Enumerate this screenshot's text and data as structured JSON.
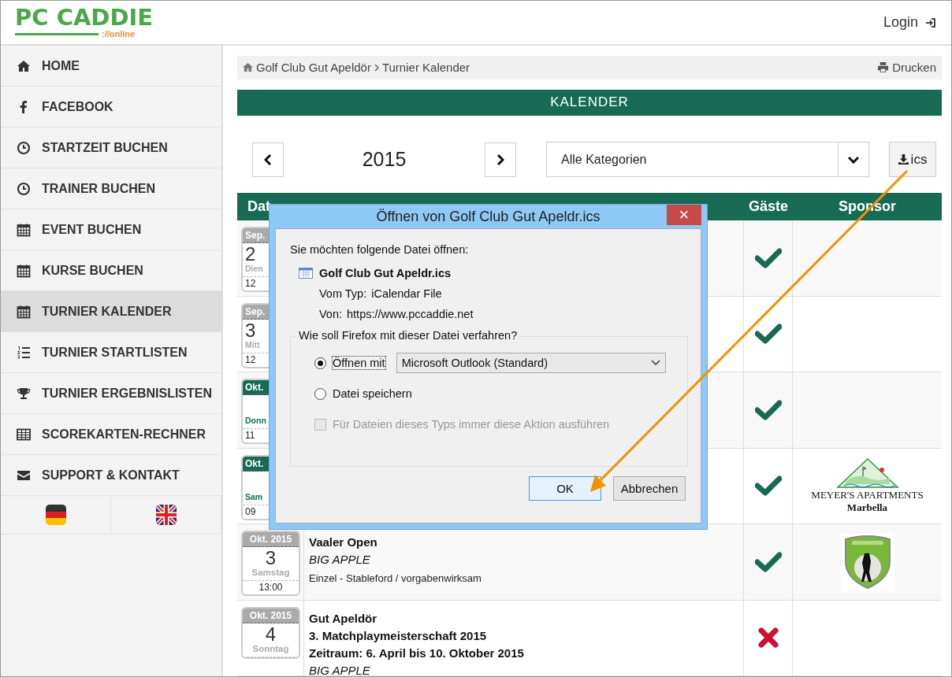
{
  "header": {
    "logo": "PC CADDIE",
    "logo_sub": "://online",
    "login": "Login"
  },
  "sidebar": {
    "items": [
      {
        "label": "HOME",
        "selected": false
      },
      {
        "label": "FACEBOOK",
        "selected": false
      },
      {
        "label": "STARTZEIT BUCHEN",
        "selected": false
      },
      {
        "label": "TRAINER BUCHEN",
        "selected": false
      },
      {
        "label": "EVENT BUCHEN",
        "selected": false
      },
      {
        "label": "KURSE BUCHEN",
        "selected": false
      },
      {
        "label": "TURNIER KALENDER",
        "selected": true
      },
      {
        "label": "TURNIER STARTLISTEN",
        "selected": false
      },
      {
        "label": "TURNIER ERGEBNISLISTEN",
        "selected": false
      },
      {
        "label": "SCOREKARTEN-RECHNER",
        "selected": false
      },
      {
        "label": "SUPPORT & KONTAKT",
        "selected": false
      }
    ]
  },
  "breadcrumb": {
    "items": [
      "Golf Club Gut Apeldör",
      "Turnier Kalender"
    ],
    "print": "Drucken"
  },
  "banner": "KALENDER",
  "controls": {
    "year": "2015",
    "category": "Alle Kategorien",
    "download": "ics"
  },
  "table": {
    "columns": [
      "Dat",
      "Gäste",
      "Sponsor"
    ],
    "rows": [
      {
        "date": {
          "month": "Sep.",
          "day": "2",
          "weekday": "Dien",
          "time": "12",
          "highlight": false
        },
        "event": [],
        "guests": true
      },
      {
        "date": {
          "month": "Sep.",
          "day": "3",
          "weekday": "Mitt",
          "time": "12",
          "highlight": false
        },
        "event": [],
        "guests": true
      },
      {
        "date": {
          "month": "Okt.",
          "weekday": "Donn",
          "time": "11",
          "highlight": true
        },
        "event": [],
        "guests": true
      },
      {
        "date": {
          "month": "Okt.",
          "weekday": "Sam",
          "time": "09",
          "highlight": true
        },
        "event": [],
        "guests": true,
        "sponsor": {
          "kind": "logo",
          "name": "MEYER'S APARTMENTS",
          "place": "Marbella"
        }
      },
      {
        "date": {
          "month": "Okt. 2015",
          "day": "3",
          "weekday": "Samstag",
          "time": "13:00",
          "highlight": false
        },
        "event": [
          {
            "kind": "title",
            "text": "Vaaler Open"
          },
          {
            "kind": "italic",
            "text": "BIG APPLE"
          },
          {
            "kind": "plain",
            "text": "Einzel - Stableford / vorgabenwirksam"
          }
        ],
        "guests": true,
        "sponsor": {
          "kind": "picture"
        }
      },
      {
        "date": {
          "month": "Okt. 2015",
          "day": "4",
          "weekday": "Sonntag",
          "highlight": false
        },
        "event": [
          {
            "kind": "title",
            "text": "Gut Apeldör"
          },
          {
            "kind": "title",
            "text": "3. Matchplaymeisterschaft 2015"
          },
          {
            "kind": "title",
            "text": "Zeitraum: 6. April bis 10. Oktober 2015"
          },
          {
            "kind": "italic",
            "text": "BIG APPLE"
          }
        ],
        "guests": false
      }
    ]
  },
  "dialog": {
    "title": "Öffnen von Golf Club Gut Apeldr.ics",
    "close": "×",
    "intro": "Sie möchten folgende Datei öffnen:",
    "filename": "Golf Club Gut Apeldr.ics",
    "type_label": "Vom Typ:",
    "type_value": "iCalendar File",
    "from_label": "Von:",
    "from_value": "https://www.pccaddie.net",
    "group": "Wie soll Firefox mit dieser Datei verfahren?",
    "options": [
      {
        "label": "Öffnen mit",
        "selected": true
      },
      {
        "label": "Datei speichern",
        "selected": false
      }
    ],
    "app": "Microsoft Outlook (Standard)",
    "remember": {
      "label": "Für Dateien dieses Typs immer diese Aktion ausführen",
      "checked": false,
      "disabled": true
    },
    "buttons": [
      {
        "label": "OK",
        "default": true
      },
      {
        "label": "Abbrechen",
        "default": false
      }
    ]
  }
}
